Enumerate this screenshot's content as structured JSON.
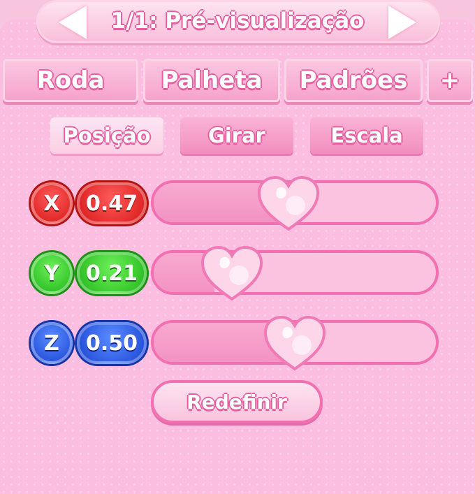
{
  "header": {
    "title": "1/1: Pré-visualização",
    "prev_icon": "triangle-left-icon",
    "next_icon": "triangle-right-icon"
  },
  "tabs": [
    {
      "label": "Roda"
    },
    {
      "label": "Palheta"
    },
    {
      "label": "Padrões"
    },
    {
      "label": "+"
    }
  ],
  "subtabs": [
    {
      "label": "Posição",
      "active": true
    },
    {
      "label": "Girar",
      "active": false
    },
    {
      "label": "Escala",
      "active": false
    }
  ],
  "sliders": [
    {
      "axis": "X",
      "value": "0.47",
      "level": 0.47,
      "color": "#d81a1a"
    },
    {
      "axis": "Y",
      "value": "0.21",
      "level": 0.21,
      "color": "#23b71c"
    },
    {
      "axis": "Z",
      "value": "0.50",
      "level": 0.5,
      "color": "#1c46d3"
    }
  ],
  "slider_handle_icon": "heart-icon",
  "reset_label": "Redefinir",
  "colors": {
    "accent": "#f26fb2",
    "panel": "#fbbde0"
  }
}
